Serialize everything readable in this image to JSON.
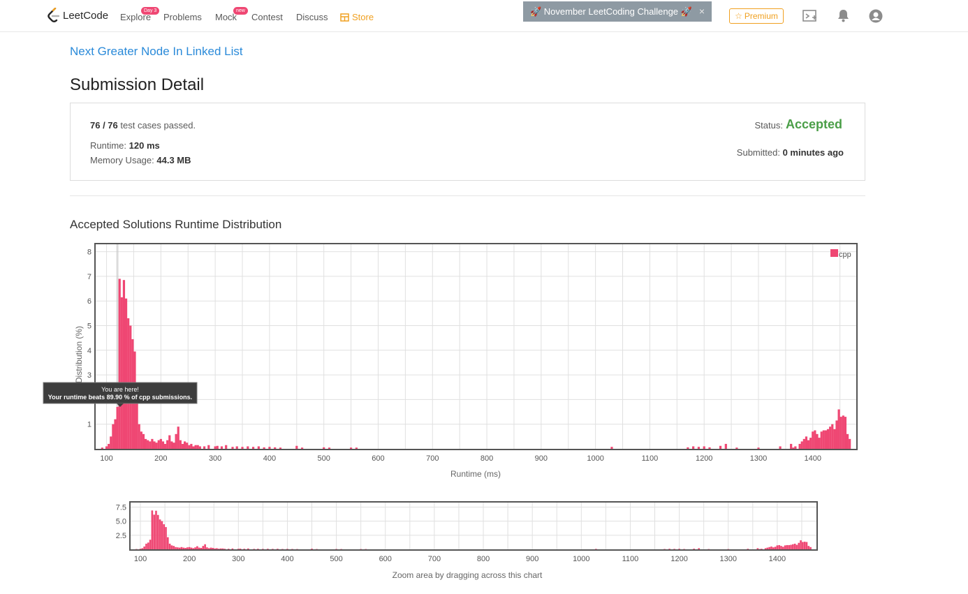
{
  "header": {
    "logo_text": "LeetCode",
    "nav": [
      {
        "label": "Explore",
        "badge": "Day 3"
      },
      {
        "label": "Problems"
      },
      {
        "label": "Mock",
        "badge": "new"
      },
      {
        "label": "Contest"
      },
      {
        "label": "Discuss"
      },
      {
        "label": "Store"
      }
    ],
    "challenge_banner": "🚀 November LeetCoding Challenge 🚀",
    "challenge_close": "×",
    "premium_label": "Premium",
    "icons": [
      "playground-icon",
      "bell-icon",
      "user-avatar-icon"
    ]
  },
  "problem_title": "Next Greater Node In Linked List",
  "page_title": "Submission Detail",
  "result": {
    "cases_passed": "76 / 76",
    "cases_suffix": "test cases passed.",
    "runtime_label": "Runtime:",
    "runtime_value": "120 ms",
    "memory_label": "Memory Usage:",
    "memory_value": "44.3 MB",
    "status_label": "Status:",
    "status_value": "Accepted",
    "submitted_label": "Submitted:",
    "submitted_value": "0 minutes ago"
  },
  "section_title": "Accepted Solutions Runtime Distribution",
  "tooltip": {
    "line1": "You are here!",
    "line2": "Your runtime beats 89.90 % of cpp submissions."
  },
  "zoom_caption": "Zoom area by dragging across this chart",
  "colors": {
    "bar": "#ef4773",
    "accent_link": "#2a8ad9",
    "accepted": "#4a9e47",
    "store": "#f0a020"
  },
  "chart_data": [
    {
      "type": "bar",
      "title": "",
      "xlabel": "Runtime (ms)",
      "ylabel": "Distribution (%)",
      "xlim": [
        80,
        1480
      ],
      "ylim": [
        0,
        8.3
      ],
      "x_ticks": [
        100,
        200,
        300,
        400,
        500,
        600,
        700,
        800,
        900,
        1000,
        1100,
        1200,
        1300,
        1400
      ],
      "y_ticks": [
        1,
        2,
        3,
        4,
        5,
        6,
        7,
        8
      ],
      "grid": true,
      "legend": "top-right",
      "series": [
        {
          "name": "cpp",
          "points": [
            [
              92,
              0.05
            ],
            [
              100,
              0.1
            ],
            [
              104,
              0.2
            ],
            [
              108,
              0.5
            ],
            [
              112,
              1.0
            ],
            [
              116,
              1.2
            ],
            [
              120,
              1.7
            ],
            [
              124,
              6.9
            ],
            [
              128,
              6.15
            ],
            [
              132,
              6.85
            ],
            [
              136,
              6.1
            ],
            [
              140,
              5.3
            ],
            [
              144,
              5.0
            ],
            [
              148,
              4.45
            ],
            [
              152,
              3.95
            ],
            [
              156,
              2.15
            ],
            [
              160,
              1.0
            ],
            [
              164,
              0.7
            ],
            [
              168,
              0.6
            ],
            [
              172,
              0.4
            ],
            [
              176,
              0.35
            ],
            [
              180,
              0.3
            ],
            [
              184,
              0.4
            ],
            [
              188,
              0.3
            ],
            [
              192,
              0.25
            ],
            [
              196,
              0.35
            ],
            [
              200,
              0.4
            ],
            [
              204,
              0.3
            ],
            [
              208,
              0.2
            ],
            [
              212,
              0.35
            ],
            [
              216,
              0.55
            ],
            [
              220,
              0.3
            ],
            [
              224,
              0.25
            ],
            [
              228,
              0.6
            ],
            [
              232,
              0.9
            ],
            [
              236,
              0.35
            ],
            [
              240,
              0.2
            ],
            [
              244,
              0.3
            ],
            [
              248,
              0.25
            ],
            [
              252,
              0.15
            ],
            [
              256,
              0.2
            ],
            [
              260,
              0.1
            ],
            [
              264,
              0.15
            ],
            [
              268,
              0.15
            ],
            [
              272,
              0.1
            ],
            [
              280,
              0.1
            ],
            [
              288,
              0.15
            ],
            [
              300,
              0.1
            ],
            [
              304,
              0.12
            ],
            [
              312,
              0.1
            ],
            [
              320,
              0.15
            ],
            [
              332,
              0.08
            ],
            [
              340,
              0.1
            ],
            [
              350,
              0.08
            ],
            [
              360,
              0.1
            ],
            [
              370,
              0.08
            ],
            [
              380,
              0.1
            ],
            [
              390,
              0.06
            ],
            [
              400,
              0.08
            ],
            [
              410,
              0.06
            ],
            [
              420,
              0.05
            ],
            [
              450,
              0.12
            ],
            [
              460,
              0.05
            ],
            [
              500,
              0.06
            ],
            [
              510,
              0.05
            ],
            [
              550,
              0.05
            ],
            [
              560,
              0.05
            ],
            [
              1030,
              0.08
            ],
            [
              1170,
              0.06
            ],
            [
              1180,
              0.1
            ],
            [
              1190,
              0.08
            ],
            [
              1200,
              0.1
            ],
            [
              1210,
              0.06
            ],
            [
              1230,
              0.12
            ],
            [
              1240,
              0.2
            ],
            [
              1260,
              0.05
            ],
            [
              1300,
              0.05
            ],
            [
              1340,
              0.1
            ],
            [
              1360,
              0.2
            ],
            [
              1364,
              0.05
            ],
            [
              1368,
              0.1
            ],
            [
              1376,
              0.2
            ],
            [
              1380,
              0.3
            ],
            [
              1384,
              0.4
            ],
            [
              1388,
              0.5
            ],
            [
              1392,
              0.35
            ],
            [
              1396,
              0.45
            ],
            [
              1400,
              0.7
            ],
            [
              1404,
              0.75
            ],
            [
              1408,
              0.6
            ],
            [
              1412,
              0.45
            ],
            [
              1416,
              0.7
            ],
            [
              1420,
              0.75
            ],
            [
              1424,
              0.75
            ],
            [
              1428,
              0.8
            ],
            [
              1432,
              0.9
            ],
            [
              1436,
              1.0
            ],
            [
              1440,
              0.8
            ],
            [
              1444,
              1.15
            ],
            [
              1448,
              1.6
            ],
            [
              1452,
              1.3
            ],
            [
              1456,
              1.35
            ],
            [
              1460,
              1.3
            ],
            [
              1464,
              0.6
            ],
            [
              1468,
              0.4
            ]
          ]
        }
      ],
      "marker": {
        "x": 120,
        "label": "You are here!"
      }
    },
    {
      "type": "bar",
      "title": "",
      "xlabel": "",
      "ylabel": "",
      "xlim": [
        80,
        1480
      ],
      "ylim": [
        0,
        8.3
      ],
      "x_ticks": [
        100,
        200,
        300,
        400,
        500,
        600,
        700,
        800,
        900,
        1000,
        1100,
        1200,
        1300,
        1400
      ],
      "y_ticks": [
        2.5,
        5.0,
        7.5
      ],
      "grid": true,
      "series": [
        {
          "name": "cpp",
          "ref": "same as main chart"
        }
      ]
    }
  ]
}
